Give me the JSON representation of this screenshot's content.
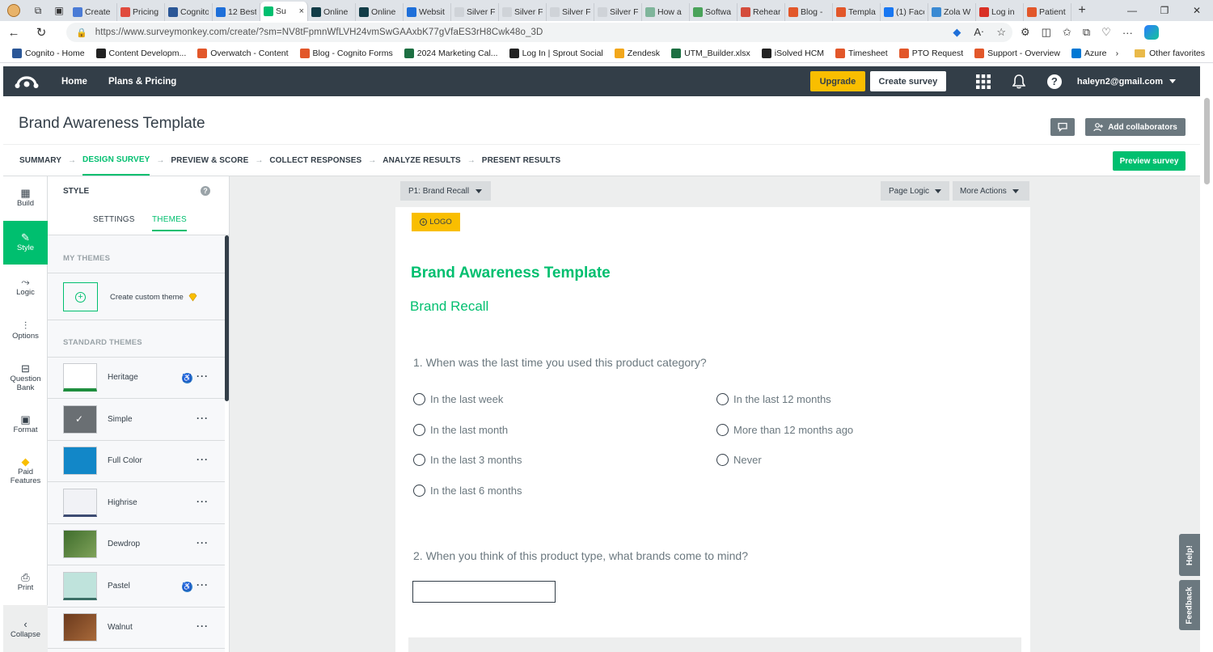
{
  "browser": {
    "tabs": [
      {
        "label": "Create",
        "color": "#4a7bd6"
      },
      {
        "label": "Pricing",
        "color": "#e04b3e"
      },
      {
        "label": "Cognito",
        "color": "#2b5797"
      },
      {
        "label": "12 Best",
        "color": "#1e6fd9"
      },
      {
        "label": "Su",
        "color": "#00bf6f",
        "active": true
      },
      {
        "label": "Online",
        "color": "#123c47"
      },
      {
        "label": "Online",
        "color": "#123c47"
      },
      {
        "label": "Websit",
        "color": "#1e6fd9"
      },
      {
        "label": "Silver F",
        "color": "#cfd3d8"
      },
      {
        "label": "Silver F",
        "color": "#cfd3d8"
      },
      {
        "label": "Silver F",
        "color": "#cfd3d8"
      },
      {
        "label": "Silver F",
        "color": "#cfd3d8"
      },
      {
        "label": "How a",
        "color": "#7fb59b"
      },
      {
        "label": "Softwa",
        "color": "#4aa35a"
      },
      {
        "label": "Rehear",
        "color": "#d44c3c"
      },
      {
        "label": "Blog -",
        "color": "#e2572a"
      },
      {
        "label": "Templa",
        "color": "#e2572a"
      },
      {
        "label": "(1) Face",
        "color": "#1877f2"
      },
      {
        "label": "Zola W",
        "color": "#3a8ad3"
      },
      {
        "label": "Log in",
        "color": "#d93025"
      },
      {
        "label": "Patient",
        "color": "#e2572a"
      }
    ],
    "active_tab_close": "×",
    "new_tab": "+",
    "url": "https://www.surveymonkey.com/create/?sm=NV8tFpmnWfLVH24vmSwGAAxbK77gVfaES3rH8Cwk48o_3D",
    "bookmarks": [
      {
        "label": "Cognito - Home",
        "color": "#2b5797"
      },
      {
        "label": "Content Developm...",
        "color": "#222222"
      },
      {
        "label": "Overwatch - Content",
        "color": "#e2572a"
      },
      {
        "label": "Blog - Cognito Forms",
        "color": "#e2572a"
      },
      {
        "label": "2024 Marketing Cal...",
        "color": "#1d6f42"
      },
      {
        "label": "Log In | Sprout Social",
        "color": "#222222"
      },
      {
        "label": "Zendesk",
        "color": "#f2a71b"
      },
      {
        "label": "UTM_Builder.xlsx",
        "color": "#1d6f42"
      },
      {
        "label": "iSolved HCM",
        "color": "#222222"
      },
      {
        "label": "Timesheet",
        "color": "#e2572a"
      },
      {
        "label": "PTO Request",
        "color": "#e2572a"
      },
      {
        "label": "Support - Overview",
        "color": "#e2572a"
      },
      {
        "label": "Azure",
        "color": "#0078d4"
      }
    ],
    "other_favorites": "Other favorites"
  },
  "nav": {
    "home": "Home",
    "plans": "Plans & Pricing",
    "upgrade": "Upgrade",
    "create_survey": "Create survey",
    "user": "haleyn2@gmail.com"
  },
  "header": {
    "title": "Brand Awareness Template",
    "add_collaborators": "Add collaborators"
  },
  "steps": [
    "SUMMARY",
    "DESIGN SURVEY",
    "PREVIEW & SCORE",
    "COLLECT RESPONSES",
    "ANALYZE RESULTS",
    "PRESENT RESULTS"
  ],
  "preview_survey": "Preview survey",
  "rail": {
    "build": "Build",
    "style": "Style",
    "logic": "Logic",
    "options": "Options",
    "question_bank_1": "Question",
    "question_bank_2": "Bank",
    "format": "Format",
    "paid_1": "Paid",
    "paid_2": "Features",
    "print": "Print",
    "collapse": "Collapse"
  },
  "style_panel": {
    "heading": "STYLE",
    "help": "?",
    "tab_settings": "SETTINGS",
    "tab_themes": "THEMES",
    "my_themes": "MY THEMES",
    "create_custom": "Create custom theme",
    "standard_themes": "STANDARD THEMES",
    "themes": [
      {
        "name": "Heritage",
        "accessible": true
      },
      {
        "name": "Simple",
        "accessible": false
      },
      {
        "name": "Full Color",
        "accessible": false
      },
      {
        "name": "Highrise",
        "accessible": false
      },
      {
        "name": "Dewdrop",
        "accessible": false
      },
      {
        "name": "Pastel",
        "accessible": true
      },
      {
        "name": "Walnut",
        "accessible": false
      }
    ]
  },
  "survey": {
    "page_select": "P1: Brand Recall",
    "page_logic": "Page Logic",
    "more_actions": "More Actions",
    "logo": "LOGO",
    "title": "Brand Awareness Template",
    "page_name": "Brand Recall",
    "q1": {
      "title": "1. When was the last time you used this product category?",
      "options_left": [
        "In the last week",
        "In the last month",
        "In the last 3 months",
        "In the last 6 months"
      ],
      "options_right": [
        "In the last 12 months",
        "More than 12 months ago",
        "Never"
      ]
    },
    "q2": {
      "title": "2. When you think of this product type, what brands come to mind?"
    }
  },
  "side_tabs": {
    "help": "Help!",
    "feedback": "Feedback"
  },
  "colors": {
    "brand_green": "#00bf6f",
    "nav_dark": "#333e48",
    "upgrade_yellow": "#f9be00"
  }
}
